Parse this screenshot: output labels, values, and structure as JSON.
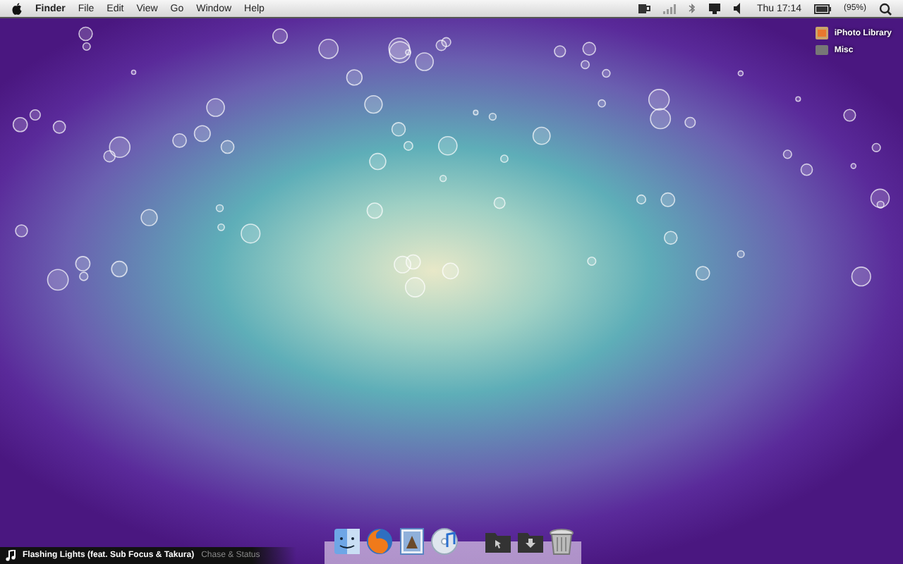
{
  "menu_bar": {
    "app_name": "Finder",
    "menus": [
      "File",
      "Edit",
      "View",
      "Go",
      "Window",
      "Help"
    ],
    "clock": "Thu 17:14",
    "battery": "(95%)"
  },
  "desktop_items": [
    {
      "label": "iPhoto Library",
      "kind": "photos"
    },
    {
      "label": "Misc",
      "kind": "folder"
    }
  ],
  "dock": [
    {
      "kind": "finder"
    },
    {
      "kind": "browser"
    },
    {
      "kind": "preview"
    },
    {
      "kind": "music"
    },
    {
      "kind": "folder"
    },
    {
      "kind": "downloads"
    },
    {
      "kind": "trash"
    }
  ],
  "now_playing": {
    "title": "Flashing Lights (feat. Sub Focus & Takura)",
    "artist": "Chase & Status"
  }
}
